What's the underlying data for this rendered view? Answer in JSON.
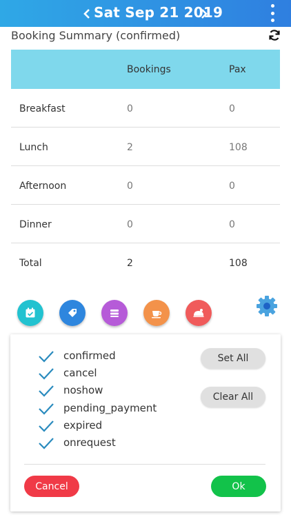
{
  "header": {
    "date": "Sat Sep 21 2019"
  },
  "summary": {
    "title": "Booking Summary (confirmed)"
  },
  "table": {
    "headers": [
      "",
      "Bookings",
      "Pax"
    ],
    "rows": [
      {
        "label": "Breakfast",
        "bookings": "0",
        "pax": "0"
      },
      {
        "label": "Lunch",
        "bookings": "2",
        "pax": "108"
      },
      {
        "label": "Afternoon",
        "bookings": "0",
        "pax": "0"
      },
      {
        "label": "Dinner",
        "bookings": "0",
        "pax": "0"
      },
      {
        "label": "Total",
        "bookings": "2",
        "pax": "108"
      }
    ]
  },
  "icons": [
    {
      "name": "calendar-icon",
      "color": "#22C2D0"
    },
    {
      "name": "tag-icon",
      "color": "#2E86DE"
    },
    {
      "name": "layers-icon",
      "color": "#B65BD8"
    },
    {
      "name": "coffee-icon",
      "color": "#F3924A"
    },
    {
      "name": "dinner-icon",
      "color": "#F05B5B"
    }
  ],
  "filters": {
    "options": [
      "confirmed",
      "cancel",
      "noshow",
      "pending_payment",
      "expired",
      "onrequest"
    ],
    "set_all_label": "Set All",
    "clear_all_label": "Clear All",
    "cancel_label": "Cancel",
    "ok_label": "Ok"
  },
  "colors": {
    "header": "#2F8FE3",
    "table_header": "#7FD8EC",
    "checkmark": "#2A8BBE",
    "cancel": "#F03A47",
    "ok": "#12C24A",
    "gear": "#4AA3DF"
  }
}
